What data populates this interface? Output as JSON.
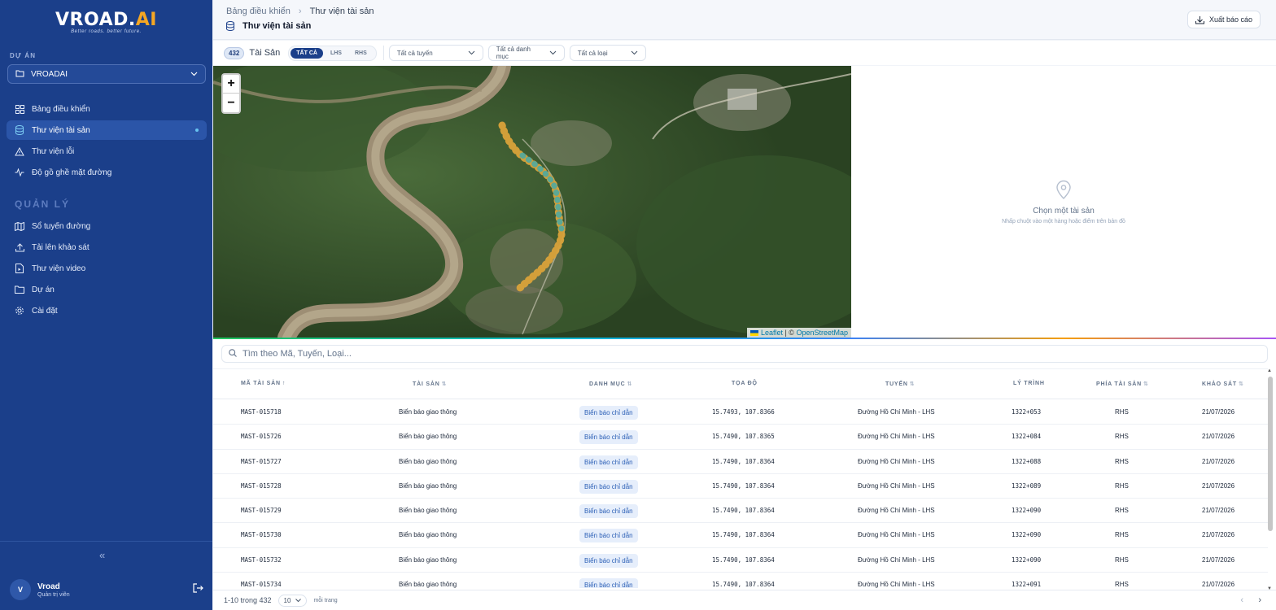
{
  "brand": {
    "logo_main_a": "VROAD.",
    "logo_main_b": "AI",
    "tagline": "Better roads. better future."
  },
  "sidebar": {
    "project_section_label": "DỰ ÁN",
    "project_name": "VROADAI",
    "nav_items": [
      {
        "label": "Bảng điều khiển",
        "icon": "dashboard-icon"
      },
      {
        "label": "Thư viện tài sản",
        "icon": "database-icon",
        "active": true
      },
      {
        "label": "Thư viện lỗi",
        "icon": "warning-icon"
      },
      {
        "label": "Độ gồ ghề mặt đường",
        "icon": "activity-icon"
      }
    ],
    "manage_section_label": "QUẢN LÝ",
    "manage_items": [
      {
        "label": "Sổ tuyến đường",
        "icon": "map-book-icon"
      },
      {
        "label": "Tải lên khảo sát",
        "icon": "upload-icon"
      },
      {
        "label": "Thư viện video",
        "icon": "video-file-icon"
      },
      {
        "label": "Dự án",
        "icon": "folder-icon"
      },
      {
        "label": "Cài đặt",
        "icon": "gear-icon"
      }
    ],
    "collapse_glyph": "«",
    "user": {
      "initial": "V",
      "name": "Vroad",
      "role": "Quản trị viên"
    }
  },
  "header": {
    "breadcrumb_root": "Bảng điều khiển",
    "breadcrumb_sep": "›",
    "breadcrumb_current": "Thư viện tài sản",
    "title": "Thư viện tài sản",
    "export_label": "Xuất báo cáo"
  },
  "filters": {
    "count": "432",
    "count_label": "Tài Sản",
    "segments": [
      "TẤT CẢ",
      "LHS",
      "RHS"
    ],
    "route_dropdown": "Tất cả tuyến",
    "category_dropdown": "Tất cả danh mục",
    "type_dropdown": "Tất cả loại"
  },
  "map": {
    "zoom_in": "+",
    "zoom_out": "−",
    "attr_leaflet": "Leaflet",
    "attr_sep": " | © ",
    "attr_osm": "OpenStreetMap"
  },
  "detail": {
    "empty_title": "Chọn một tài sản",
    "empty_sub": "Nhấp chuột vào một hàng hoặc điểm trên bản đồ"
  },
  "table": {
    "search_placeholder": "Tìm theo Mã, Tuyến, Loại...",
    "columns": [
      "MÃ TÀI SẢN",
      "TÀI SẢN",
      "DANH MỤC",
      "TỌA ĐỘ",
      "TUYẾN",
      "LÝ TRÌNH",
      "PHÍA TÀI SẢN",
      "KHẢO SÁT"
    ],
    "sort_asc": "↑",
    "sort_both": "⇅",
    "rows": [
      {
        "id": "MAST-015718",
        "asset": "Biển báo giao thông",
        "category": "Biển báo chỉ dẫn",
        "coords": "15.7493, 107.8366",
        "route": "Đường Hồ Chí Minh - LHS",
        "chainage": "1322+053",
        "side": "RHS",
        "survey": "21/07/2026"
      },
      {
        "id": "MAST-015726",
        "asset": "Biển báo giao thông",
        "category": "Biển báo chỉ dẫn",
        "coords": "15.7490, 107.8365",
        "route": "Đường Hồ Chí Minh - LHS",
        "chainage": "1322+084",
        "side": "RHS",
        "survey": "21/07/2026"
      },
      {
        "id": "MAST-015727",
        "asset": "Biển báo giao thông",
        "category": "Biển báo chỉ dẫn",
        "coords": "15.7490, 107.8364",
        "route": "Đường Hồ Chí Minh - LHS",
        "chainage": "1322+088",
        "side": "RHS",
        "survey": "21/07/2026"
      },
      {
        "id": "MAST-015728",
        "asset": "Biển báo giao thông",
        "category": "Biển báo chỉ dẫn",
        "coords": "15.7490, 107.8364",
        "route": "Đường Hồ Chí Minh - LHS",
        "chainage": "1322+089",
        "side": "RHS",
        "survey": "21/07/2026"
      },
      {
        "id": "MAST-015729",
        "asset": "Biển báo giao thông",
        "category": "Biển báo chỉ dẫn",
        "coords": "15.7490, 107.8364",
        "route": "Đường Hồ Chí Minh - LHS",
        "chainage": "1322+090",
        "side": "RHS",
        "survey": "21/07/2026"
      },
      {
        "id": "MAST-015730",
        "asset": "Biển báo giao thông",
        "category": "Biển báo chỉ dẫn",
        "coords": "15.7490, 107.8364",
        "route": "Đường Hồ Chí Minh - LHS",
        "chainage": "1322+090",
        "side": "RHS",
        "survey": "21/07/2026"
      },
      {
        "id": "MAST-015732",
        "asset": "Biển báo giao thông",
        "category": "Biển báo chỉ dẫn",
        "coords": "15.7490, 107.8364",
        "route": "Đường Hồ Chí Minh - LHS",
        "chainage": "1322+090",
        "side": "RHS",
        "survey": "21/07/2026"
      },
      {
        "id": "MAST-015734",
        "asset": "Biển báo giao thông",
        "category": "Biển báo chỉ dẫn",
        "coords": "15.7490, 107.8364",
        "route": "Đường Hồ Chí Minh - LHS",
        "chainage": "1322+091",
        "side": "RHS",
        "survey": "21/07/2026"
      }
    ]
  },
  "pager": {
    "range": "1-10 trong 432",
    "page_size": "10",
    "per_page_label": "mỗi trang",
    "prev": "‹",
    "next": "›"
  },
  "colors": {
    "sidebar_bg": "#1b3f8a",
    "accent": "#f5a623",
    "tag_bg": "#e6eefb",
    "tag_text": "#2b5fb6",
    "marker_orange": "#d9a23a",
    "marker_teal": "#4fa8a0"
  }
}
